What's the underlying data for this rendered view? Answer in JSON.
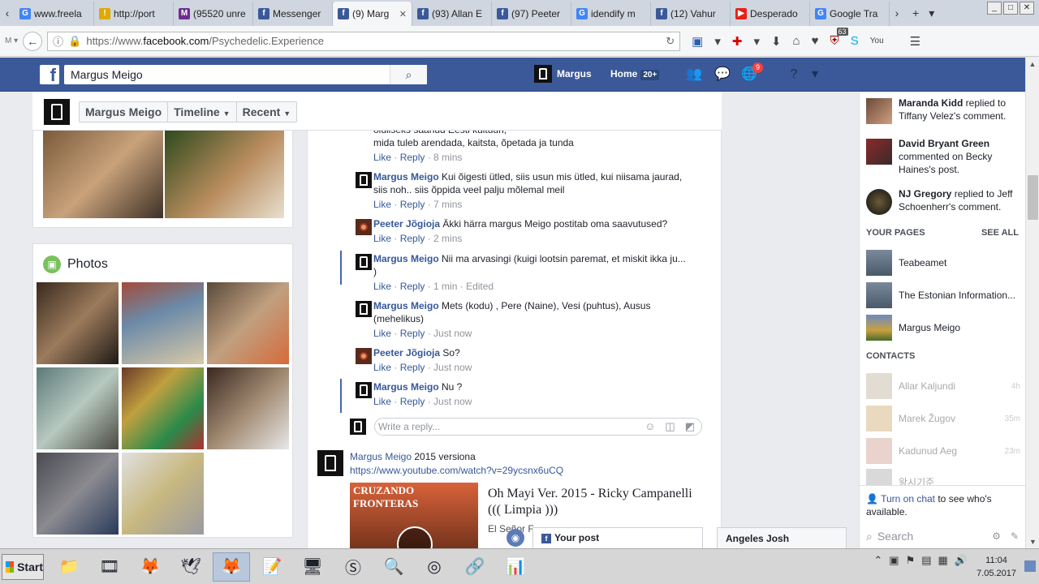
{
  "browser": {
    "tabs": [
      {
        "label": "www.freela",
        "fav": "G",
        "color": "#4285f4"
      },
      {
        "label": "http://port",
        "fav": "!",
        "color": "#e0a800"
      },
      {
        "label": "(95520 unre",
        "fav": "M",
        "color": "#6b2e8f"
      },
      {
        "label": "Messenger",
        "fav": "f",
        "color": "#3b5998"
      },
      {
        "label": "(9) Marg",
        "fav": "f",
        "color": "#3b5998",
        "active": true
      },
      {
        "label": "(93) Allan E",
        "fav": "f",
        "color": "#3b5998"
      },
      {
        "label": "(97) Peeter",
        "fav": "f",
        "color": "#3b5998"
      },
      {
        "label": "idendify m",
        "fav": "G",
        "color": "#4285f4"
      },
      {
        "label": "(12) Vahur",
        "fav": "f",
        "color": "#3b5998"
      },
      {
        "label": "Desperado",
        "fav": "▶",
        "color": "#e62117"
      },
      {
        "label": "Google Tra",
        "fav": "G",
        "color": "#4285f4"
      }
    ],
    "url_prefix": "https://www.",
    "url_domain": "facebook.com",
    "url_path": "/Psychedelic.Experience",
    "ublock_count": "63"
  },
  "fb": {
    "search_value": "Margus Meigo",
    "user_name": "Margus",
    "home_label": "Home",
    "home_count": "20+",
    "notif_count": "9"
  },
  "timeline_nav": {
    "name": "Margus Meigo",
    "timeline": "Timeline",
    "recent": "Recent"
  },
  "photos": {
    "title": "Photos"
  },
  "comments": [
    {
      "name": "",
      "text": "oluliseks saanud Eesti kultuuri,",
      "text2": "mida tuleb arendada, kaitsta, õpetada ja tunda",
      "like": "Like",
      "reply": "Reply",
      "time": "8 mins",
      "edited": ""
    },
    {
      "name": "Margus Meigo",
      "text": " Kui õigesti ütled, siis usun mis ütled, kui niisama jaurad,",
      "text2": "siis noh.. siis õppida veel palju mõlemal meil",
      "like": "Like",
      "reply": "Reply",
      "time": "7 mins",
      "edited": ""
    },
    {
      "name": "Peeter Jõgioja",
      "text": " Äkki härra margus Meigo postitab oma saavutused?",
      "text2": "",
      "like": "Like",
      "reply": "Reply",
      "time": "2 mins",
      "edited": ""
    },
    {
      "name": "Margus Meigo",
      "text": " Nii ma arvasingi (kuigi lootsin paremat, et miskit ikka ju...",
      "text2": ")",
      "like": "Like",
      "reply": "Reply",
      "time": "1 min",
      "edited": "Edited"
    },
    {
      "name": "Margus Meigo",
      "text": " Mets (kodu) , Pere (Naine), Vesi (puhtus), Ausus",
      "text2": "(mehelikus)",
      "like": "Like",
      "reply": "Reply",
      "time": "Just now",
      "edited": ""
    },
    {
      "name": "Peeter Jõgioja",
      "text": " So?",
      "text2": "",
      "like": "Like",
      "reply": "Reply",
      "time": "Just now",
      "edited": ""
    },
    {
      "name": "Margus Meigo",
      "text": " Nu ?",
      "text2": "",
      "like": "Like",
      "reply": "Reply",
      "time": "Just now",
      "edited": ""
    }
  ],
  "reply_placeholder": "Write a reply...",
  "post2": {
    "author": "Margus Meigo",
    "text": " 2015 versiona",
    "link": "https://www.youtube.com/watch?v=29ycsnx6uCQ",
    "thumb_text": "CRUZANDO FRONTERAS",
    "video_title": "Oh Mayi Ver. 2015 - Ricky Campanelli ((( Limpia )))",
    "video_desc": "El Señor F"
  },
  "ticker": [
    {
      "name": "Maranda Kidd",
      "action": " replied to Tiffany Velez's comment."
    },
    {
      "name": "David Bryant Green",
      "action": " commented on Becky Haines's post."
    },
    {
      "name": "NJ Gregory",
      "action": " replied to Jeff Schoenherr's comment."
    }
  ],
  "your_pages": {
    "title": "YOUR PAGES",
    "see_all": "SEE ALL",
    "items": [
      "Teabeamet",
      "The Estonian Information...",
      "Margus Meigo"
    ]
  },
  "contacts": {
    "title": "CONTACTS",
    "items": [
      {
        "name": "Allar Kaljundi",
        "time": "4h"
      },
      {
        "name": "Marek Žugov",
        "time": "35m"
      },
      {
        "name": "Kadunud Aeg",
        "time": "23m"
      },
      {
        "name": "왕시기준",
        "time": ""
      }
    ]
  },
  "chat": {
    "turn_on": "Turn on chat",
    "rest": " to see who's available.",
    "search": "Search"
  },
  "dock": {
    "your_post": "Your post",
    "chat_name": "Angeles Josh"
  },
  "taskbar": {
    "start": "Start",
    "time": "11:04",
    "date": "7.05.2017"
  }
}
